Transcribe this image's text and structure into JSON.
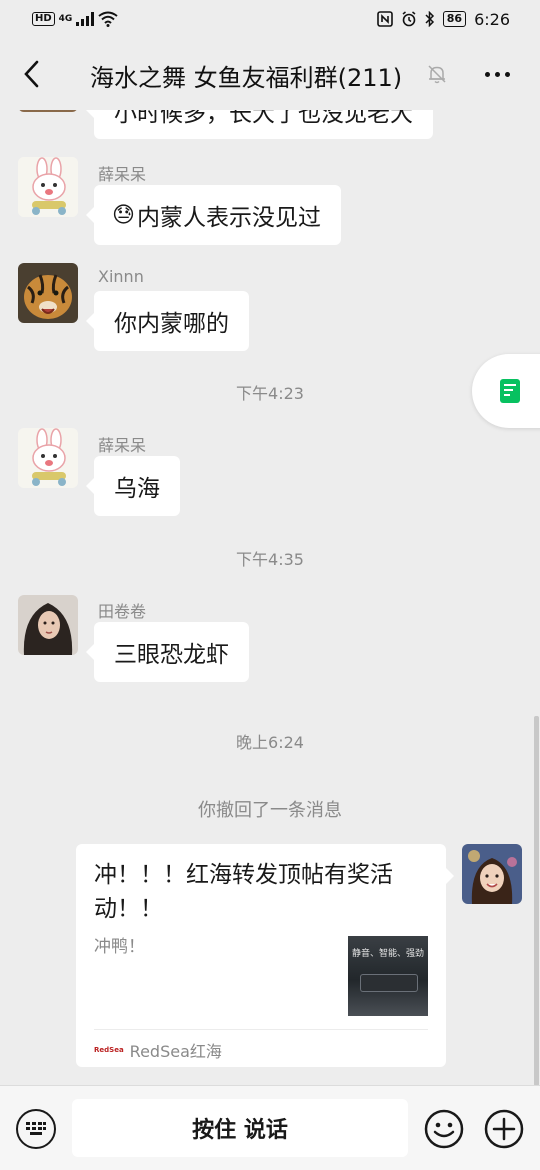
{
  "status_bar": {
    "hd": "HD",
    "network": "4G",
    "battery": "86",
    "time": "6:26"
  },
  "nav": {
    "title": "海水之舞 女鱼友福利群(211)"
  },
  "messages": [
    {
      "text": "小时候多，长大了也没见老大"
    },
    {
      "sender": "薛呆呆",
      "text": "内蒙人表示没见过",
      "emoji": "😓"
    },
    {
      "sender": "Xinnn",
      "text": "你内蒙哪的"
    },
    {
      "sender": "薛呆呆",
      "text": "乌海"
    },
    {
      "sender": "田卷卷",
      "text": "三眼恐龙虾"
    }
  ],
  "timestamps": [
    "下午4:23",
    "下午4:35",
    "晚上6:24"
  ],
  "system_message": "你撤回了一条消息",
  "shared_card": {
    "title": "冲！！！红海转发顶帖有奖活动！！",
    "description": "冲鸭！",
    "thumb_text": "静音、智能、强劲",
    "logo_text": "RedSea",
    "source": "RedSea红海"
  },
  "input_bar": {
    "hold_to_talk": "按住 说话"
  },
  "colors": {
    "background": "#ededed",
    "bubble": "#ffffff",
    "accent_green": "#07c160"
  }
}
